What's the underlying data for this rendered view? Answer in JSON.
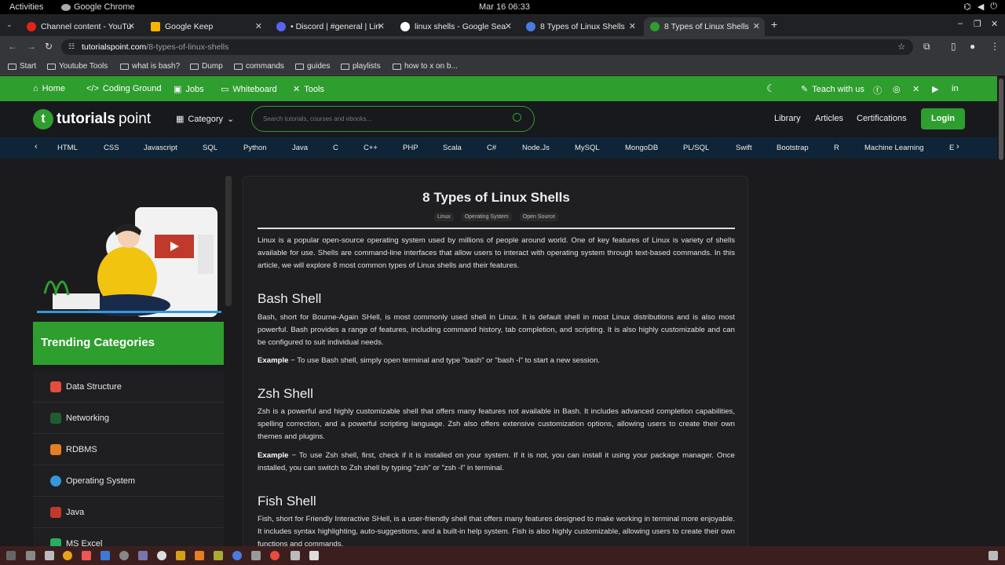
{
  "os_bar": {
    "activities": "Activities",
    "app_name": "Google Chrome",
    "clock": "Mar 16  06:33"
  },
  "tabs": [
    {
      "title": "Channel content - YouTu",
      "color": "#e62117"
    },
    {
      "title": "Google Keep",
      "color": "#f6b400"
    },
    {
      "title": "• Discord | #general | Lin",
      "color": "#5865f2"
    },
    {
      "title": "linux shells - Google Sea",
      "color": "#ffffff"
    },
    {
      "title": "8 Types of Linux Shells",
      "color": "#4a7be0"
    },
    {
      "title": "8 Types of Linux Shells",
      "color": "#2e9e2e"
    }
  ],
  "address": {
    "domain": "tutorialspoint.com",
    "path": "/8-types-of-linux-shells"
  },
  "bookmarks": [
    "Start",
    "Youtube Tools",
    "what is bash?",
    "Dump",
    "commands",
    "guides",
    "playlists",
    "how to x on b..."
  ],
  "topnav": {
    "home": "Home",
    "coding_ground": "Coding Ground",
    "jobs": "Jobs",
    "whiteboard": "Whiteboard",
    "tools": "Tools",
    "teach": "Teach with us"
  },
  "header": {
    "logo_a": "tutorials",
    "logo_b": "point",
    "category": "Category",
    "search_placeholder": "Search tutorials, courses and ebooks...",
    "library": "Library",
    "articles": "Articles",
    "certifications": "Certifications",
    "login": "Login"
  },
  "languages": [
    "HTML",
    "CSS",
    "Javascript",
    "SQL",
    "Python",
    "Java",
    "C",
    "C++",
    "PHP",
    "Scala",
    "C#",
    "Node.Js",
    "MySQL",
    "MongoDB",
    "PL/SQL",
    "Swift",
    "Bootstrap",
    "R",
    "Machine Learning",
    "E"
  ],
  "sidebar": {
    "trending_title": "Trending Categories",
    "items": [
      {
        "label": "Data Structure",
        "color": "#e74c3c"
      },
      {
        "label": "Networking",
        "color": "#2e9e2e"
      },
      {
        "label": "RDBMS",
        "color": "#e67e22"
      },
      {
        "label": "Operating System",
        "color": "#3498db"
      },
      {
        "label": "Java",
        "color": "#c0392b"
      },
      {
        "label": "MS Excel",
        "color": "#27ae60"
      }
    ]
  },
  "article": {
    "title": "8 Types of Linux Shells",
    "tags": [
      "Linux",
      "Operating System",
      "Open Source"
    ],
    "intro": "Linux is a popular open-source operating system used by millions of people around world. One of key features of Linux is variety of shells available for use. Shells are command-line interfaces that allow users to interact with operating system through text-based commands. In this article, we will explore 8 most common types of Linux shells and their features.",
    "bash_h": "Bash Shell",
    "bash_p": "Bash, short for Bourne-Again SHell, is most commonly used shell in Linux. It is default shell in most Linux distributions and is also most powerful. Bash provides a range of features, including command history, tab completion, and scripting. It is also highly customizable and can be configured to suit individual needs.",
    "bash_ex_label": "Example",
    "bash_ex": " − To use Bash shell, simply open terminal and type \"bash\" or \"bash -l\" to start a new session.",
    "zsh_h": "Zsh Shell",
    "zsh_p": "Zsh is a powerful and highly customizable shell that offers many features not available in Bash. It includes advanced completion capabilities, spelling correction, and a powerful scripting language. Zsh also offers extensive customization options, allowing users to create their own themes and plugins.",
    "zsh_ex_label": "Example",
    "zsh_ex": " − To use Zsh shell, first, check if it is installed on your system. If it is not, you can install it using your package manager. Once installed, you can switch to Zsh shell by typing \"zsh\" or \"zsh -l\" in terminal.",
    "fish_h": "Fish Shell",
    "fish_p": "Fish, short for Friendly Interactive SHell, is a user-friendly shell that offers many features designed to make working in terminal more enjoyable. It includes syntax highlighting, auto-suggestions, and a built-in help system. Fish is also highly customizable, allowing users to create their own functions and commands."
  }
}
